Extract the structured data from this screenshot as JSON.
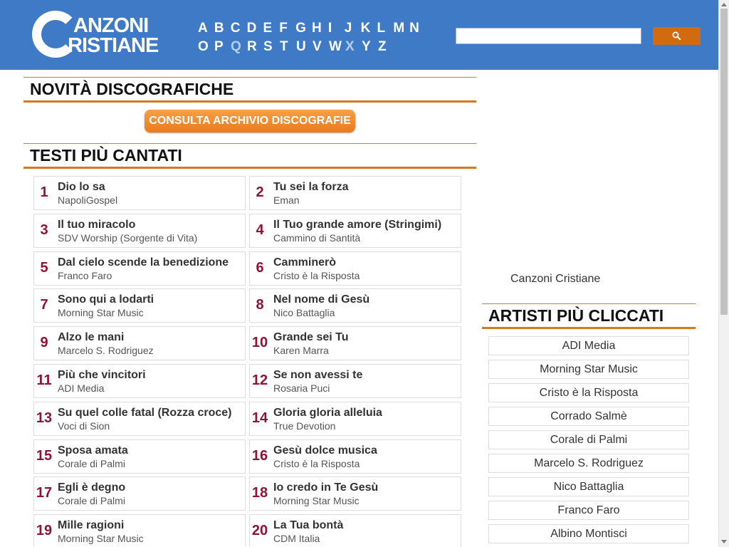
{
  "header": {
    "logo_line1": "ANZONI",
    "logo_line2": "RISTIANE",
    "alphabet_row1": [
      "A",
      "B",
      "C",
      "D",
      "E",
      "F",
      "G",
      "H",
      "I",
      "J",
      "K",
      "L",
      "M",
      "N"
    ],
    "alphabet_row2": [
      "O",
      "P",
      "Q",
      "R",
      "S",
      "T",
      "U",
      "V",
      "W",
      "X",
      "Y",
      "Z"
    ],
    "search_placeholder": "",
    "accent_color": "#3f7ac7",
    "search_button_color": "#d26b10",
    "search_icon": "search-icon"
  },
  "news": {
    "title": "NOVITÀ DISCOGRAFICHE",
    "archive_button": "CONSULTA ARCHIVIO DISCOGRAFIE"
  },
  "top_songs": {
    "title": "TESTI PIÙ CANTATI",
    "items": [
      {
        "n": "1",
        "title": "Dio lo sa",
        "artist": "NapoliGospel"
      },
      {
        "n": "2",
        "title": "Tu sei la forza",
        "artist": "Eman"
      },
      {
        "n": "3",
        "title": "Il tuo miracolo",
        "artist": "SDV Worship (Sorgente di Vita)"
      },
      {
        "n": "4",
        "title": "Il Tuo grande amore (Stringimi)",
        "artist": "Cammino di Santità"
      },
      {
        "n": "5",
        "title": "Dal cielo scende la benedizione",
        "artist": "Franco Faro"
      },
      {
        "n": "6",
        "title": "Camminerò",
        "artist": "Cristo è la Risposta"
      },
      {
        "n": "7",
        "title": "Sono qui a lodarti",
        "artist": "Morning Star Music"
      },
      {
        "n": "8",
        "title": "Nel nome di Gesù",
        "artist": "Nico Battaglia"
      },
      {
        "n": "9",
        "title": "Alzo le mani",
        "artist": "Marcelo S. Rodriguez"
      },
      {
        "n": "10",
        "title": "Grande sei Tu",
        "artist": "Karen Marra"
      },
      {
        "n": "11",
        "title": "Più che vincitori",
        "artist": "ADI Media"
      },
      {
        "n": "12",
        "title": "Se non avessi te",
        "artist": "Rosaria Puci"
      },
      {
        "n": "13",
        "title": "Su quel colle fatal (Rozza croce)",
        "artist": "Voci di Sion"
      },
      {
        "n": "14",
        "title": "Gloria gloria alleluia",
        "artist": "True Devotion"
      },
      {
        "n": "15",
        "title": "Sposa amata",
        "artist": "Corale di Palmi"
      },
      {
        "n": "16",
        "title": "Gesù dolce musica",
        "artist": "Cristo è la Risposta"
      },
      {
        "n": "17",
        "title": "Egli è degno",
        "artist": "Corale di Palmi"
      },
      {
        "n": "18",
        "title": "Io credo in Te Gesù",
        "artist": "Morning Star Music"
      },
      {
        "n": "19",
        "title": "Mille ragioni",
        "artist": "Morning Star Music"
      },
      {
        "n": "20",
        "title": "La Tua bontà",
        "artist": "CDM Italia"
      }
    ]
  },
  "sidebar": {
    "ad_label": "Canzoni Cristiane",
    "artists_title": "ARTISTI PIÙ CLICCATI",
    "artists": [
      "ADI Media",
      "Morning Star Music",
      "Cristo è la Risposta",
      "Corrado Salmè",
      "Corale di Palmi",
      "Marcelo S. Rodriguez",
      "Nico Battaglia",
      "Franco Faro",
      "Albino Montisci"
    ]
  }
}
